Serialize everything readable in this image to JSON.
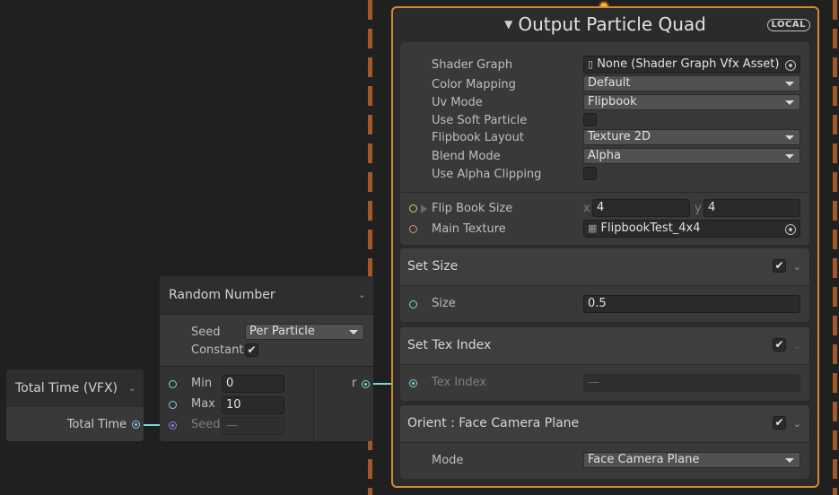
{
  "total_time_node": {
    "title": "Total Time (VFX)",
    "output_label": "Total Time"
  },
  "random_node": {
    "title": "Random Number",
    "seed_label": "Seed",
    "seed_value": "Per Particle",
    "constant_label": "Constant",
    "constant_checked": "✔",
    "min_label": "Min",
    "min_value": "0",
    "max_label": "Max",
    "max_value": "10",
    "seed_port_label": "Seed",
    "seed_port_value": "—",
    "output_label": "r"
  },
  "output_context": {
    "title": "Output Particle Quad",
    "badge": "LOCAL",
    "settings": {
      "shader_graph_label": "Shader Graph",
      "shader_graph_value": "None (Shader Graph Vfx Asset)",
      "color_mapping_label": "Color Mapping",
      "color_mapping_value": "Default",
      "uv_mode_label": "Uv Mode",
      "uv_mode_value": "Flipbook",
      "soft_particle_label": "Use Soft Particle",
      "flipbook_layout_label": "Flipbook Layout",
      "flipbook_layout_value": "Texture 2D",
      "blend_mode_label": "Blend Mode",
      "blend_mode_value": "Alpha",
      "alpha_clipping_label": "Use Alpha Clipping"
    },
    "inputs": {
      "flip_book_size_label": "Flip Book Size",
      "x_label": "x",
      "x_value": "4",
      "y_label": "y",
      "y_value": "4",
      "main_texture_label": "Main Texture",
      "main_texture_value": "FlipbookTest_4x4"
    }
  },
  "blocks": {
    "set_size": {
      "title": "Set Size",
      "checked": "✔",
      "size_label": "Size",
      "size_value": "0.5"
    },
    "set_tex_index": {
      "title": "Set Tex Index",
      "checked": "✔",
      "tex_index_label": "Tex Index",
      "tex_index_value": "—"
    },
    "orient": {
      "title": "Orient : Face Camera Plane",
      "checked": "✔",
      "mode_label": "Mode",
      "mode_value": "Face Camera Plane"
    }
  },
  "colors": {
    "context_border": "#d08a34",
    "flow_line": "#a4572a",
    "float_port": "#7bd6df",
    "vector_port": "#9ee06a",
    "texture_port": "#e38a7a",
    "seed_port": "#8b7ff0"
  },
  "icons": [
    "vfx-icon",
    "chevron-down-icon",
    "checkmark-icon",
    "object-picker-icon",
    "file-icon",
    "texture-icon",
    "expand-triangle-icon",
    "dropdown-caret-icon"
  ]
}
